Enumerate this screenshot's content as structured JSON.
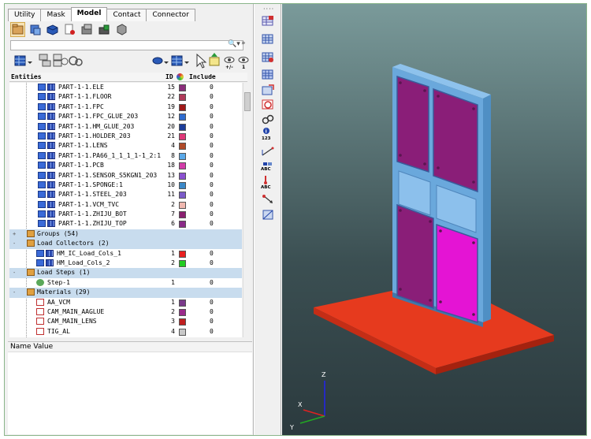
{
  "tabs": [
    "Utility",
    "Mask",
    "Model",
    "Contact",
    "Connector"
  ],
  "active_tab": "Model",
  "tree_header": {
    "entities": "Entities",
    "id": "ID",
    "include": "Include"
  },
  "rows": [
    {
      "kind": "part",
      "name": "PART-1-1.ELE",
      "id": "15",
      "color": "#8a2d7a",
      "inc": "0"
    },
    {
      "kind": "part",
      "name": "PART-1-1.FLOOR",
      "id": "22",
      "color": "#b03a5a",
      "inc": "0"
    },
    {
      "kind": "part",
      "name": "PART-1-1.FPC",
      "id": "19",
      "color": "#a01818",
      "inc": "0"
    },
    {
      "kind": "part",
      "name": "PART-1-1.FPC_GLUE_203",
      "id": "12",
      "color": "#2e6bcf",
      "inc": "0"
    },
    {
      "kind": "part",
      "name": "PART-1-1.HM_GLUE_203",
      "id": "20",
      "color": "#1c3d9a",
      "inc": "0"
    },
    {
      "kind": "part",
      "name": "PART-1-1.HOLDER_203",
      "id": "21",
      "color": "#e03878",
      "inc": "0"
    },
    {
      "kind": "part",
      "name": "PART-1-1.LENS",
      "id": "4",
      "color": "#b04a28",
      "inc": "0"
    },
    {
      "kind": "part",
      "name": "PART-1-1.PA66_1_1_1_1-1_2:1",
      "id": "8",
      "color": "#5aa8e8",
      "inc": "0"
    },
    {
      "kind": "part",
      "name": "PART-1-1.PCB",
      "id": "18",
      "color": "#d23ca8",
      "inc": "0"
    },
    {
      "kind": "part",
      "name": "PART-1-1.SENSOR_S5KGN1_203",
      "id": "13",
      "color": "#8a50d0",
      "inc": "0"
    },
    {
      "kind": "part",
      "name": "PART-1-1.SPONGE:1",
      "id": "10",
      "color": "#3b88c8",
      "inc": "0"
    },
    {
      "kind": "part",
      "name": "PART-1-1.STEEL_203",
      "id": "11",
      "color": "#7a5ac8",
      "inc": "0"
    },
    {
      "kind": "part",
      "name": "PART-1-1.VCM_TVC",
      "id": "2",
      "color": "#f0b8b0",
      "inc": "0"
    },
    {
      "kind": "part",
      "name": "PART-1-1.ZHIJU_BOT",
      "id": "7",
      "color": "#8a2070",
      "inc": "0"
    },
    {
      "kind": "part",
      "name": "PART-1-1.ZHIJU_TOP",
      "id": "6",
      "color": "#8a2a88",
      "inc": "0"
    },
    {
      "kind": "group",
      "name": "Groups (54)",
      "sel": true
    },
    {
      "kind": "group",
      "name": "Load Collectors (2)",
      "sel": true
    },
    {
      "kind": "lc",
      "name": "HM_IC_Load_Cols_1",
      "id": "1",
      "color": "#e82020",
      "inc": "0"
    },
    {
      "kind": "lc",
      "name": "HM_Load_Cols_2",
      "id": "2",
      "color": "#22cc22",
      "inc": "0"
    },
    {
      "kind": "group",
      "name": "Load Steps (1)",
      "sel": true
    },
    {
      "kind": "step",
      "name": "Step-1",
      "id": "1",
      "inc": "0"
    },
    {
      "kind": "group",
      "name": "Materials (29)",
      "sel": true
    },
    {
      "kind": "mat",
      "name": "AA_VCM",
      "id": "1",
      "color": "#7a3a8a",
      "inc": "0"
    },
    {
      "kind": "mat",
      "name": "CAM_MAIN_AAGLUE",
      "id": "2",
      "color": "#9a2a8a",
      "inc": "0"
    },
    {
      "kind": "mat",
      "name": "CAM_MAIN_LENS",
      "id": "3",
      "color": "#c02020",
      "inc": "0"
    },
    {
      "kind": "mat",
      "name": "TIG_AL",
      "id": "4",
      "color": "#c8c8c8",
      "inc": "0"
    }
  ],
  "name_value_header": "Name Value",
  "vbar_labels": {
    "l123": "123",
    "abc1": "ABC",
    "abc2": "ABC"
  },
  "axes": {
    "x": "X",
    "y": "Y",
    "z": "Z"
  },
  "colors": {
    "background_top": "#7a9a9a",
    "base_plate": "#e63a1e",
    "frame": "#6aa8dc",
    "panel_purple": "#8a1e78",
    "panel_magenta": "#e414d4"
  }
}
